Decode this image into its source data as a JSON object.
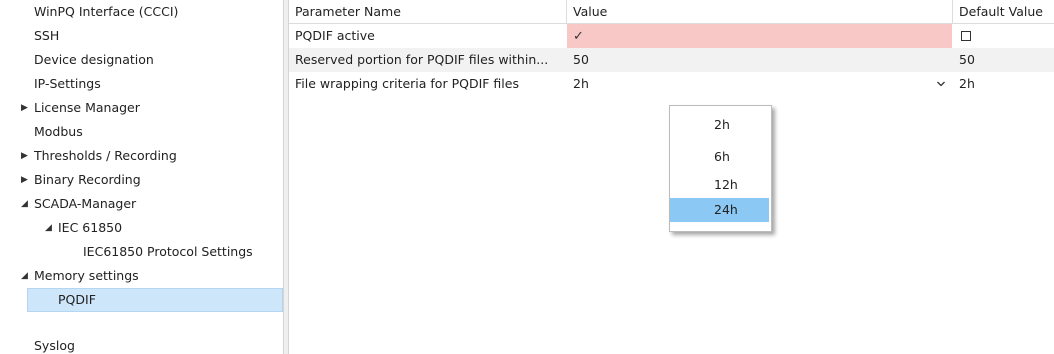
{
  "tree": {
    "items": [
      {
        "label": "WinPQ Interface (CCCI)",
        "arrow": ""
      },
      {
        "label": "SSH",
        "arrow": ""
      },
      {
        "label": "Device designation",
        "arrow": ""
      },
      {
        "label": "IP-Settings",
        "arrow": ""
      },
      {
        "label": "License Manager",
        "arrow": "▶"
      },
      {
        "label": "Modbus",
        "arrow": ""
      },
      {
        "label": "Thresholds / Recording",
        "arrow": "▶"
      },
      {
        "label": "Binary Recording",
        "arrow": "▶"
      },
      {
        "label": "SCADA-Manager",
        "arrow": "◢"
      },
      {
        "label": "IEC 61850",
        "arrow": "◢"
      },
      {
        "label": "IEC61850 Protocol Settings",
        "arrow": ""
      },
      {
        "label": "Memory settings",
        "arrow": "◢"
      },
      {
        "label": "PQDIF",
        "arrow": ""
      },
      {
        "label": "Syslog",
        "arrow": ""
      }
    ]
  },
  "grid": {
    "headers": {
      "name": "Parameter Name",
      "value": "Value",
      "default": "Default Value"
    },
    "rows": [
      {
        "name": "PQDIF active",
        "value": "✓",
        "default": ""
      },
      {
        "name": "Reserved portion for PQDIF files within...",
        "value": "50",
        "default": "50"
      },
      {
        "name": "File wrapping criteria for PQDIF files",
        "value": "2h",
        "default": "2h"
      }
    ]
  },
  "dropdown": {
    "options": [
      "2h",
      "6h",
      "12h",
      "24h"
    ],
    "highlighted": "24h"
  },
  "colors": {
    "selection": "#cde6fa",
    "error_cell": "#f8c8c6",
    "dropdown_highlight": "#8cc8f4"
  }
}
